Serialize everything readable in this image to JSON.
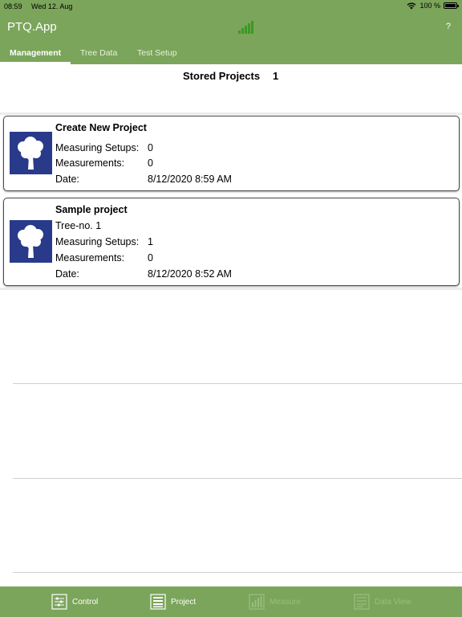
{
  "status": {
    "time": "08:59",
    "date": "Wed 12. Aug",
    "battery_text": "100 %"
  },
  "app": {
    "title": "PTQ.App",
    "help_label": "?"
  },
  "tabs": [
    {
      "label": "Management",
      "active": true
    },
    {
      "label": "Tree Data",
      "active": false
    },
    {
      "label": "Test Setup",
      "active": false
    }
  ],
  "stored_projects": {
    "label": "Stored Projects",
    "count": "1"
  },
  "cards": [
    {
      "title": "Create New Project",
      "measuring_setups_label": "Measuring Setups:",
      "measuring_setups_value": "0",
      "measurements_label": "Measurements:",
      "measurements_value": "0",
      "date_label": "Date:",
      "date_value": "8/12/2020 8:59 AM"
    },
    {
      "title": "Sample project",
      "subtitle": "Tree-no. 1",
      "measuring_setups_label": "Measuring Setups:",
      "measuring_setups_value": "1",
      "measurements_label": "Measurements:",
      "measurements_value": "0",
      "date_label": "Date:",
      "date_value": "8/12/2020 8:52 AM"
    }
  ],
  "bottom_tabs": [
    {
      "label": "Control",
      "icon": "control-icon",
      "enabled": true
    },
    {
      "label": "Project",
      "icon": "project-icon",
      "enabled": true
    },
    {
      "label": "Measure",
      "icon": "measure-icon",
      "enabled": false
    },
    {
      "label": "Data View",
      "icon": "data-view-icon",
      "enabled": false
    }
  ],
  "colors": {
    "bar_green": "#7ba55a",
    "signal_green": "#3a9a22",
    "tree_icon_blue": "#2a3a8a"
  }
}
